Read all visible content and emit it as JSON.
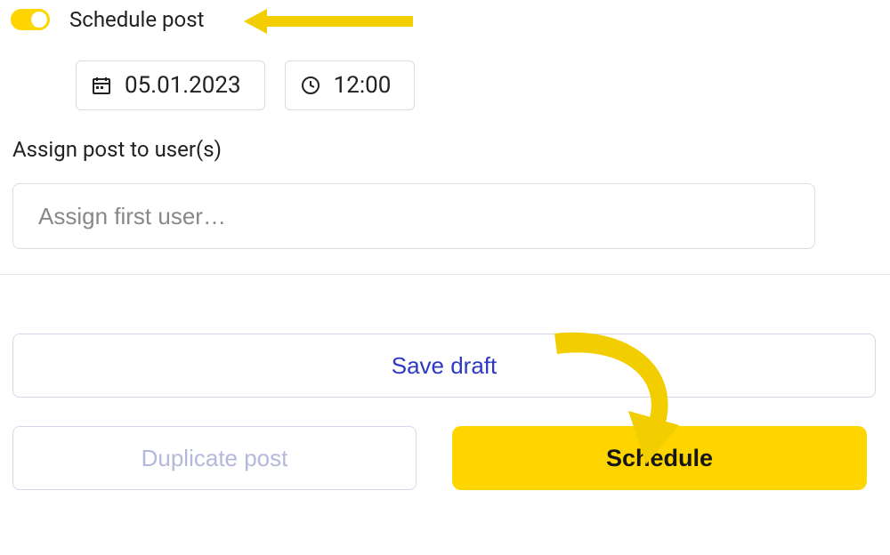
{
  "colors": {
    "accent": "#FFD500",
    "link": "#2B39C5",
    "muted": "#b5b8db"
  },
  "schedule_toggle": {
    "label": "Schedule post",
    "on": true
  },
  "date_field": {
    "value": "05.01.2023"
  },
  "time_field": {
    "value": "12:00"
  },
  "assign": {
    "label": "Assign post to user(s)",
    "placeholder": "Assign first user…",
    "value": ""
  },
  "buttons": {
    "save_draft": "Save draft",
    "duplicate": "Duplicate post",
    "schedule": "Schedule"
  }
}
